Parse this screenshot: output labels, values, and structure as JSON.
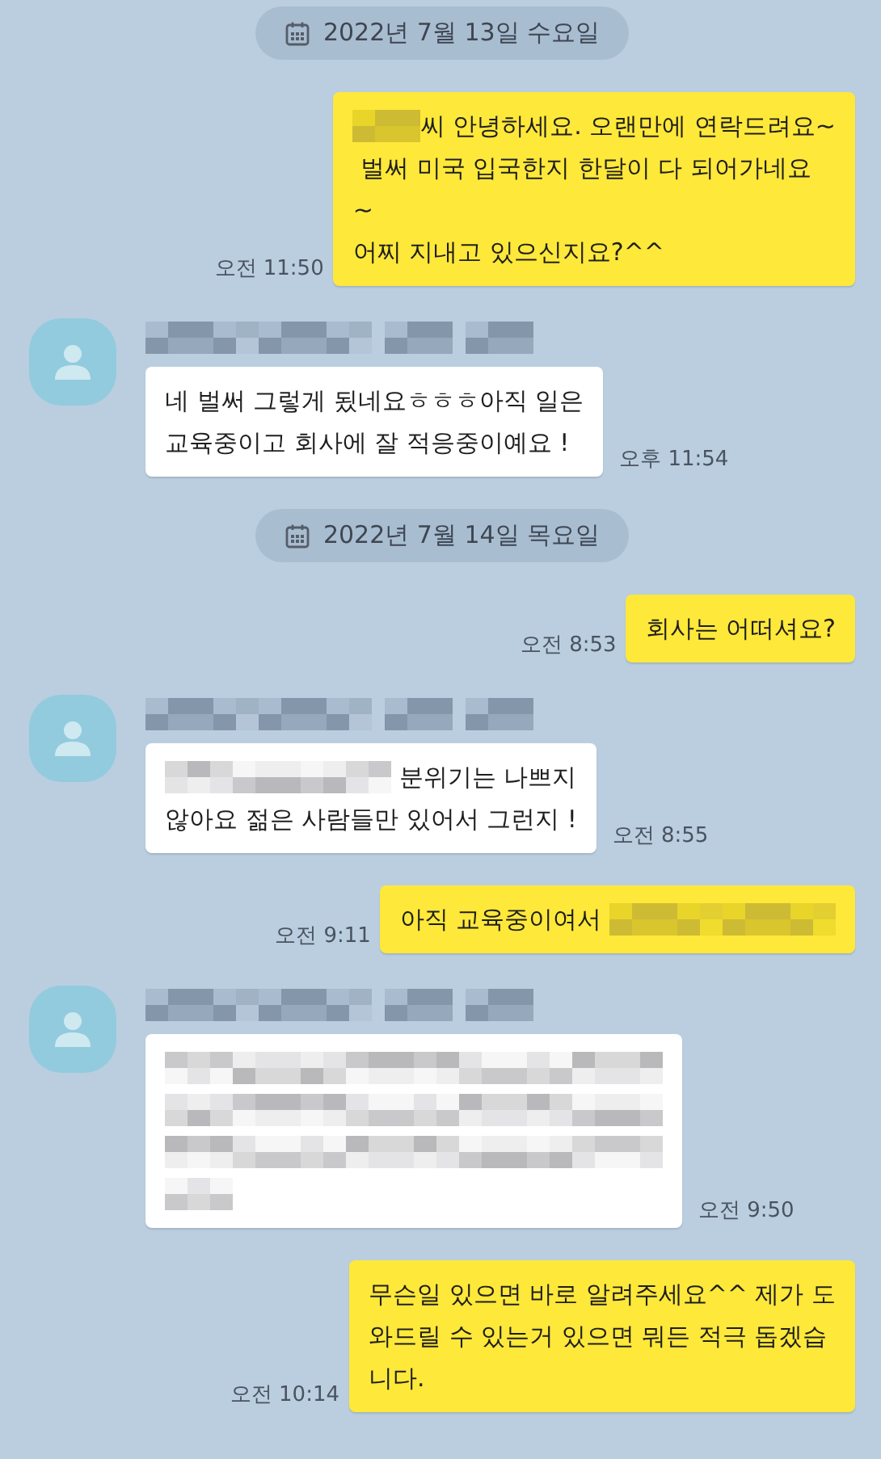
{
  "chat": [
    {
      "kind": "date",
      "text": "2022년 7월 13일 수요일"
    },
    {
      "kind": "sent",
      "time": "오전 11:50",
      "lines": [
        [
          {
            "kind": "redacted",
            "wide": false
          },
          {
            "kind": "text",
            "text": "씨 안녕하세요. 오랜만에 연락드려요~"
          }
        ],
        [
          {
            "kind": "text",
            "text": " 벌써 미국 입국한지 한달이 다 되어가네요"
          }
        ],
        [
          {
            "kind": "text",
            "text": "~"
          }
        ],
        [
          {
            "kind": "text",
            "text": "어찌 지내고 있으신지요?^^"
          }
        ]
      ]
    },
    {
      "kind": "received",
      "time": "오후 11:54",
      "lines": [
        [
          {
            "kind": "text",
            "text": "네 벌써 그렇게 됬네요ㅎㅎㅎ아직 일은"
          }
        ],
        [
          {
            "kind": "text",
            "text": "교육중이고 회사에 잘 적응중이예요 !"
          }
        ]
      ]
    },
    {
      "kind": "date",
      "text": "2022년 7월 14일 목요일"
    },
    {
      "kind": "sent",
      "time": "오전 8:53",
      "lines": [
        [
          {
            "kind": "text",
            "text": "회사는 어떠셔요?"
          }
        ]
      ]
    },
    {
      "kind": "received",
      "time": "오전 8:55",
      "lines": [
        [
          {
            "kind": "redacted",
            "wide": true
          },
          {
            "kind": "text",
            "text": " 분위기는 나쁘지"
          }
        ],
        [
          {
            "kind": "text",
            "text": "않아요 젊은 사람들만 있어서 그런지 !"
          }
        ]
      ]
    },
    {
      "kind": "sent",
      "time": "오전 9:11",
      "lines": [
        [
          {
            "kind": "text",
            "text": "아직 교육중이여서 "
          },
          {
            "kind": "redacted",
            "wide": true
          }
        ]
      ]
    },
    {
      "kind": "received",
      "time": "오전 9:50",
      "lines": [
        [
          {
            "kind": "redacted",
            "wide": true
          }
        ],
        [
          {
            "kind": "redacted",
            "wide": true
          }
        ],
        [
          {
            "kind": "redacted",
            "wide": true
          }
        ],
        [
          {
            "kind": "redacted",
            "wide": false
          }
        ]
      ]
    },
    {
      "kind": "sent",
      "time": "오전 10:14",
      "lines": [
        [
          {
            "kind": "text",
            "text": "무슨일 있으면 바로 알려주세요^^ 제가 도"
          }
        ],
        [
          {
            "kind": "text",
            "text": "와드릴 수 있는거 있으면 뭐든 적극 돕겠습"
          }
        ],
        [
          {
            "kind": "text",
            "text": "니다."
          }
        ]
      ]
    }
  ]
}
